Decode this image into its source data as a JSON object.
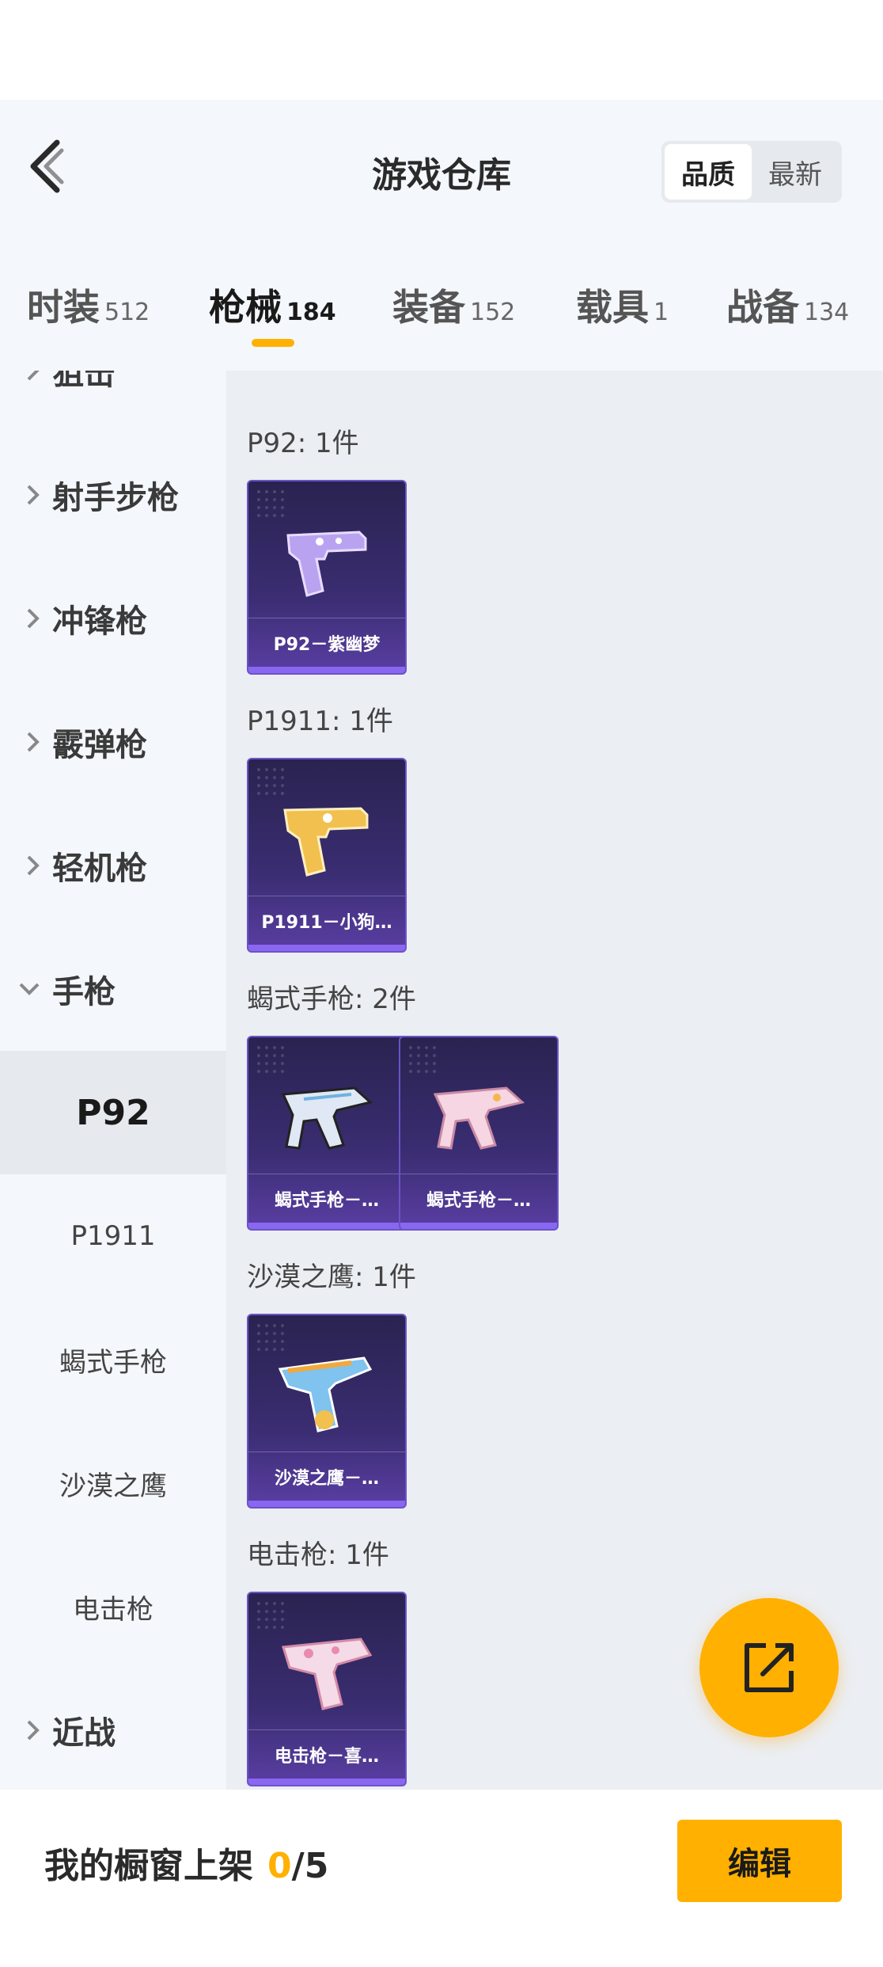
{
  "header": {
    "title": "游戏仓库",
    "sort_options": [
      {
        "label": "品质",
        "active": true
      },
      {
        "label": "最新",
        "active": false
      }
    ]
  },
  "tabs": [
    {
      "label": "时装",
      "count": "512",
      "active": false
    },
    {
      "label": "枪械",
      "count": "184",
      "active": true
    },
    {
      "label": "装备",
      "count": "152",
      "active": false
    },
    {
      "label": "载具",
      "count": "1",
      "active": false
    },
    {
      "label": "战备",
      "count": "134",
      "active": false
    }
  ],
  "sidebar": {
    "categories": [
      {
        "label": "射手步枪",
        "expanded": false
      },
      {
        "label": "冲锋枪",
        "expanded": false
      },
      {
        "label": "霰弹枪",
        "expanded": false
      },
      {
        "label": "轻机枪",
        "expanded": false
      },
      {
        "label": "手枪",
        "expanded": true
      }
    ],
    "partial_top_label": "狙击",
    "subitems": [
      {
        "label": "P92",
        "active": true
      },
      {
        "label": "P1911",
        "active": false
      },
      {
        "label": "蝎式手枪",
        "active": false
      },
      {
        "label": "沙漠之鹰",
        "active": false
      },
      {
        "label": "电击枪",
        "active": false
      }
    ],
    "last_category": {
      "label": "近战",
      "expanded": false
    }
  },
  "groups": [
    {
      "title": "P92: 1件",
      "items": [
        {
          "name": "P92－紫幽梦",
          "icon": "purple-pistol-icon"
        }
      ]
    },
    {
      "title": "P1911: 1件",
      "items": [
        {
          "name": "P1911－小狗…",
          "icon": "gold-pistol-icon"
        }
      ]
    },
    {
      "title": "蝎式手枪: 2件",
      "items": [
        {
          "name": "蝎式手枪－…",
          "icon": "smg-pistol-icon"
        },
        {
          "name": "蝎式手枪－…",
          "icon": "pink-smg-pistol-icon"
        }
      ]
    },
    {
      "title": "沙漠之鹰: 1件",
      "items": [
        {
          "name": "沙漠之鹰－…",
          "icon": "water-gun-icon"
        }
      ]
    },
    {
      "title": "电击枪: 1件",
      "items": [
        {
          "name": "电击枪－喜…",
          "icon": "taser-icon"
        }
      ]
    }
  ],
  "bottom": {
    "shelf_label": "我的橱窗上架",
    "shelf_count": "0",
    "shelf_total": "/5",
    "edit_label": "编辑"
  },
  "colors": {
    "accent": "#ffb000",
    "card_top": "#2a2350",
    "card_bottom": "#5a3ea3",
    "background": "#f4f7fb",
    "content_bg": "#ebeef2"
  }
}
